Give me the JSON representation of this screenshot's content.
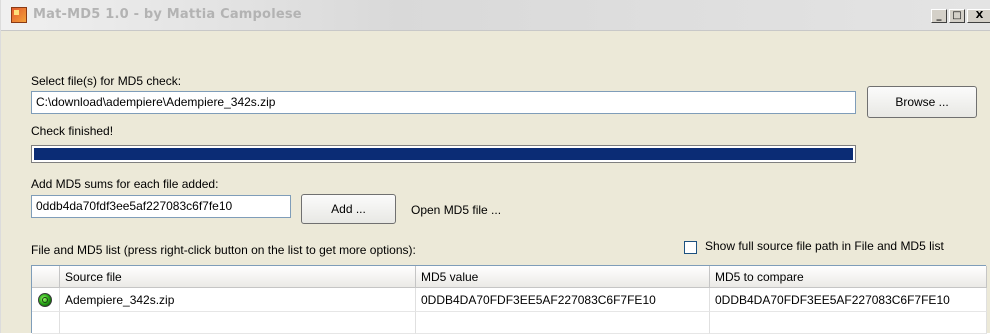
{
  "window": {
    "title": "Mat-MD5 1.0 - by Mattia Campolese",
    "controls": {
      "minimize": "_",
      "maximize": "□",
      "close": "X"
    }
  },
  "select": {
    "label": "Select file(s) for MD5 check:",
    "path_value": "C:\\download\\adempiere\\Adempiere_342s.zip",
    "browse_label": "Browse ..."
  },
  "status": {
    "text": "Check finished!",
    "progress_fraction": 1.0
  },
  "add_md5": {
    "label": "Add MD5 sums for each file added:",
    "value": "0ddb4da70fdf3ee5af227083c6f7fe10",
    "add_label": "Add ...",
    "open_label": "Open MD5 file ..."
  },
  "list": {
    "label": "File and MD5 list (press right-click button on the list to get more options):",
    "show_full_path_label": "Show full source file path in File and MD5 list",
    "show_full_path_checked": false,
    "columns": [
      "",
      "Source file",
      "MD5 value",
      "MD5 to compare"
    ],
    "rows": [
      {
        "status_icon": "green-ok-icon",
        "source_file": "Adempiere_342s.zip",
        "md5_value": "0DDB4DA70FDF3EE5AF227083C6F7FE10",
        "md5_compare": "0DDB4DA70FDF3EE5AF227083C6F7FE10"
      }
    ]
  },
  "colors": {
    "progress_fill": "#0b2c75",
    "window_bg": "#ece9d8",
    "status_ok": "#2fae1c"
  }
}
